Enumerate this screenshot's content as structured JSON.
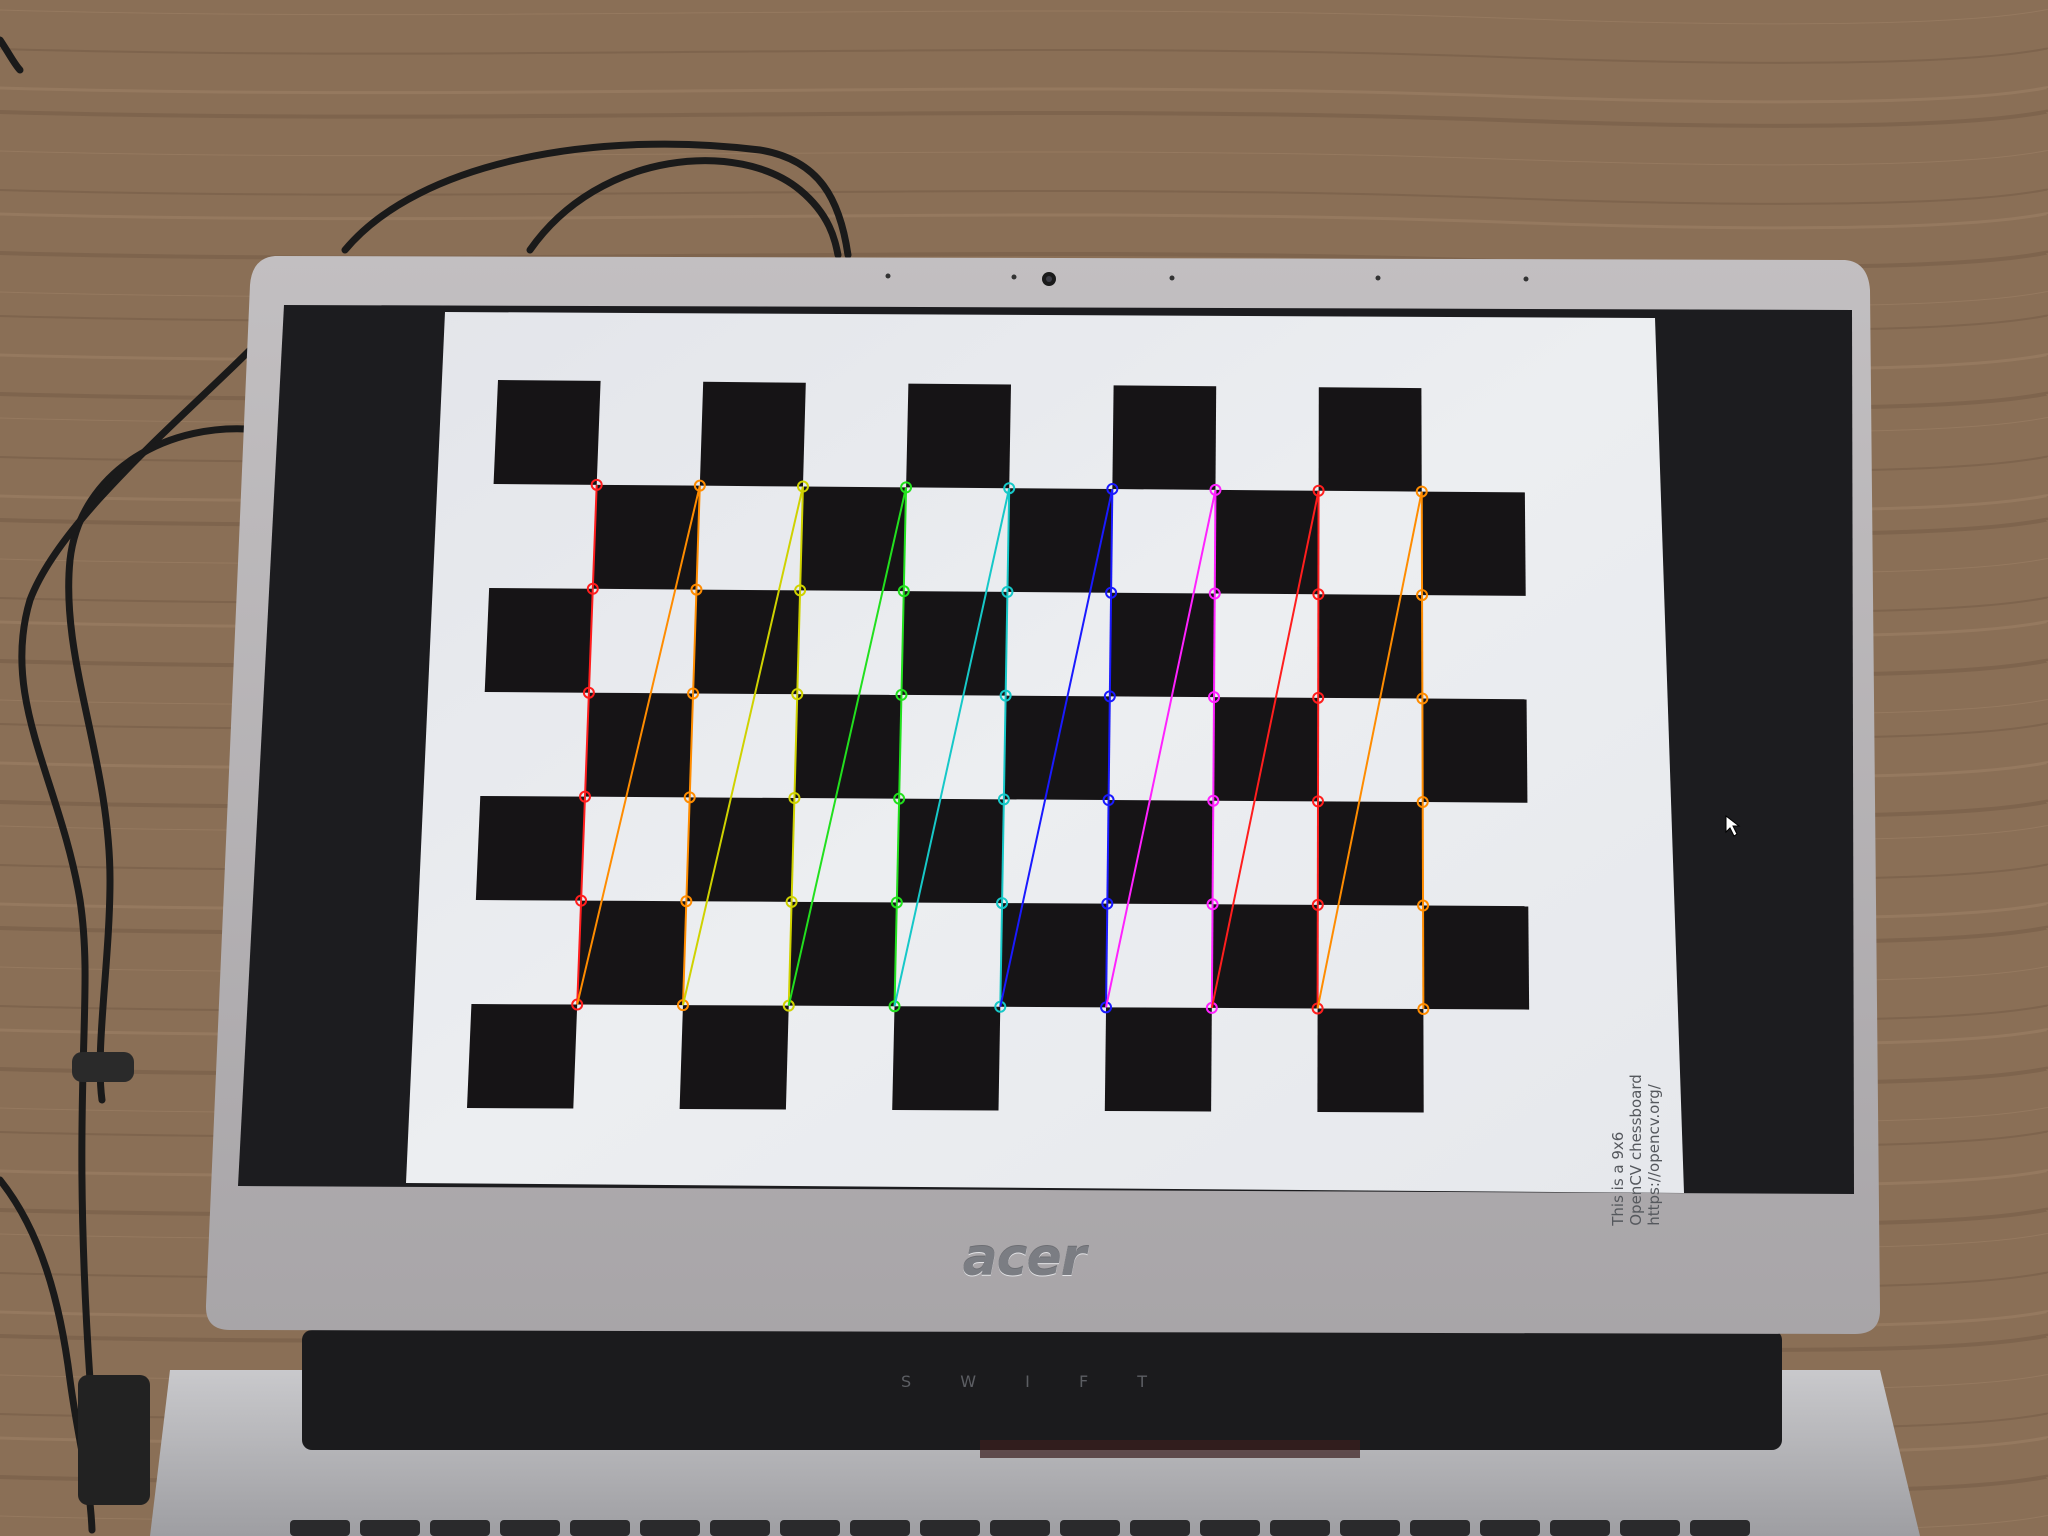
{
  "scene": {
    "description_free": true,
    "colors": {
      "desk": "#8a6f56",
      "desk_grain_dark": "#6e5642",
      "desk_grain_light": "#a2866a",
      "laptop_lid": "#b7b4b6",
      "bezel": "#1c1c1f",
      "screen_paper": "#e9eaee",
      "chess_dark": "#161416",
      "cable": "#1a1a1a"
    }
  },
  "screen_caption": {
    "line1": "This is a 9x6",
    "line2": "OpenCV chessboard",
    "line3": "https://opencv.org/"
  },
  "laptop": {
    "brand": "acer",
    "model_letters": [
      "S",
      "W",
      "I",
      "F",
      "T"
    ]
  },
  "chessboard": {
    "columns": 10,
    "rows": 7,
    "inner_corners": {
      "columns": 9,
      "rows": 6
    },
    "overlay_colors": [
      "#ff1e1e",
      "#ff8c00",
      "#cfd200",
      "#22e01e",
      "#16c8c8",
      "#1a1aff",
      "#ff22ff",
      "#ff1e1e",
      "#ff8c00"
    ]
  }
}
